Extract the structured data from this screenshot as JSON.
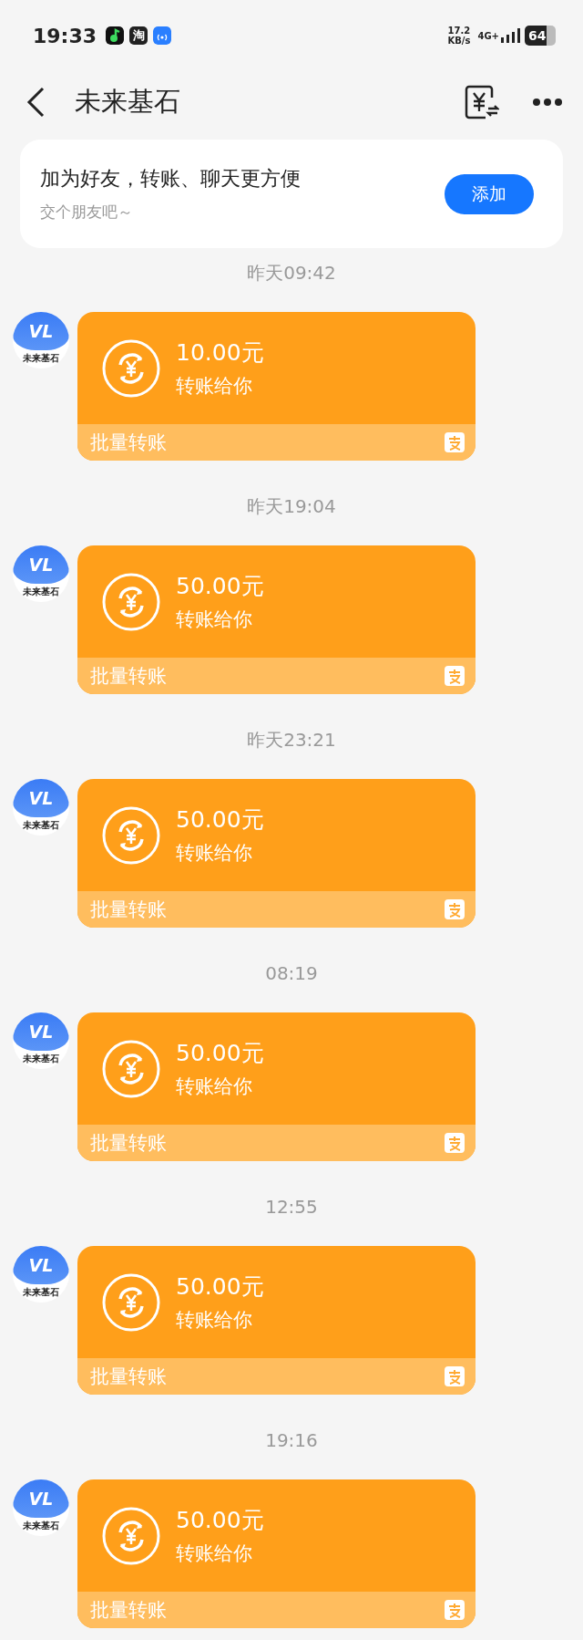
{
  "status_bar": {
    "time": "19:33",
    "app_badge": "淘",
    "speed_value": "17.2",
    "speed_unit": "KB/s",
    "network": "4G+",
    "battery": "64"
  },
  "header": {
    "title": "未来基石"
  },
  "friend_prompt": {
    "title": "加为好友，转账、聊天更方便",
    "subtitle": "交个朋友吧～",
    "button": "添加"
  },
  "messages": [
    {
      "time": "昨天09:42",
      "avatar_logo": "VL",
      "avatar_name": "未来基石",
      "amount": "10.00元",
      "caption": "转账给你",
      "footer": "批量转账"
    },
    {
      "time": "昨天19:04",
      "avatar_logo": "VL",
      "avatar_name": "未来基石",
      "amount": "50.00元",
      "caption": "转账给你",
      "footer": "批量转账"
    },
    {
      "time": "昨天23:21",
      "avatar_logo": "VL",
      "avatar_name": "未来基石",
      "amount": "50.00元",
      "caption": "转账给你",
      "footer": "批量转账"
    },
    {
      "time": "08:19",
      "avatar_logo": "VL",
      "avatar_name": "未来基石",
      "amount": "50.00元",
      "caption": "转账给你",
      "footer": "批量转账"
    },
    {
      "time": "12:55",
      "avatar_logo": "VL",
      "avatar_name": "未来基石",
      "amount": "50.00元",
      "caption": "转账给你",
      "footer": "批量转账"
    },
    {
      "time": "19:16",
      "avatar_logo": "VL",
      "avatar_name": "未来基石",
      "amount": "50.00元",
      "caption": "转账给你",
      "footer": "批量转账"
    }
  ]
}
